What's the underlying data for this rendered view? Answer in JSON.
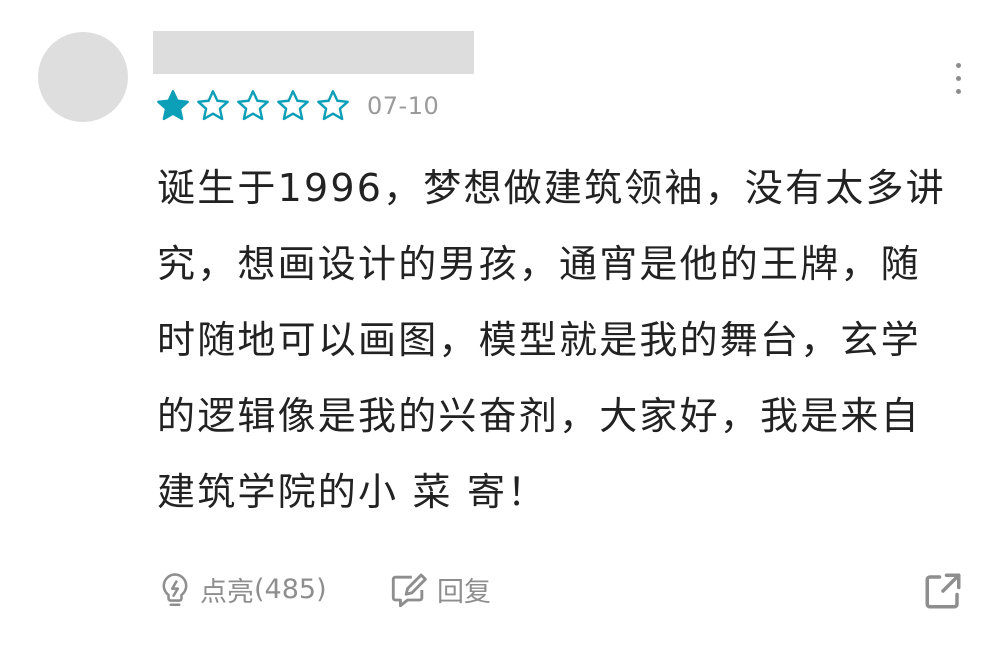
{
  "comment": {
    "rating": 1,
    "rating_max": 5,
    "date": "07-10",
    "text": "诞生于1996，梦想做建筑领袖，没有太多讲究，想画设计的男孩，通宵是他的王牌，随时随地可以画图，模型就是我的舞台，玄学的逻辑像是我的兴奋剂，大家好，我是来自建筑学院的小 菜 寄！"
  },
  "actions": {
    "like_label": "点亮",
    "like_count": "(485)",
    "reply_label": "回复"
  },
  "icons": {
    "star": "star-icon",
    "more": "more-vertical-icon",
    "like": "lightbulb-icon",
    "reply": "edit-icon",
    "share": "share-icon"
  },
  "colors": {
    "star_filled": "#0b9fb8",
    "star_outline": "#0b9fb8",
    "muted": "#8e8e8e",
    "text": "#222222"
  }
}
